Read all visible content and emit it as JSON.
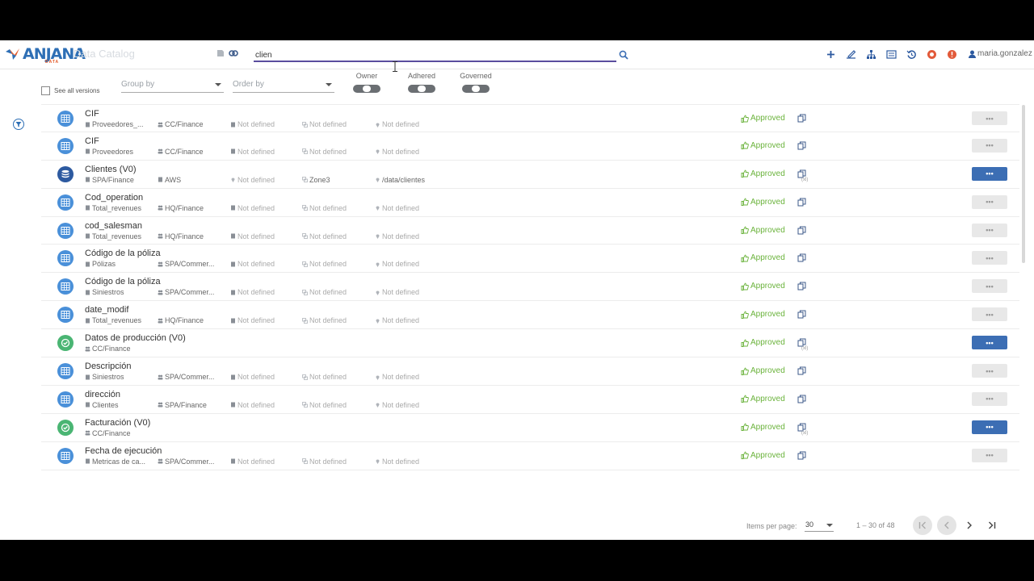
{
  "app": {
    "brand": "ANJANA",
    "brand_sub": "DATA",
    "title": "Data Catalog"
  },
  "search": {
    "value": "clien",
    "placeholder": ""
  },
  "user": {
    "name": "maria.gonzalez"
  },
  "top_actions": [
    {
      "name": "add-icon"
    },
    {
      "name": "edit-lineage-icon"
    },
    {
      "name": "hierarchy-icon"
    },
    {
      "name": "list-view-icon"
    },
    {
      "name": "history-icon"
    },
    {
      "name": "notifications-icon"
    },
    {
      "name": "alerts-icon"
    }
  ],
  "filters": {
    "see_all_versions": "See all versions",
    "group_by": "Group by",
    "order_by": "Order by",
    "owner": "Owner",
    "adhered": "Adhered",
    "governed": "Governed"
  },
  "rows": [
    {
      "name": "CIF",
      "icon": "table",
      "m1": "Proveedores_...",
      "m2": "CC/Finance",
      "m3": "Not defined",
      "m4": "Not defined",
      "m5": "Not defined",
      "status": "Approved",
      "active": false,
      "xl": ""
    },
    {
      "name": "CIF",
      "icon": "table",
      "m1": "Proveedores",
      "m2": "CC/Finance",
      "m3": "Not defined",
      "m4": "Not defined",
      "m5": "Not defined",
      "status": "Approved",
      "active": false,
      "xl": ""
    },
    {
      "name": "Clientes (V0)",
      "icon": "db",
      "m1": "SPA/Finance",
      "m2": "AWS",
      "m3": "Not defined",
      "m4": "Zone3",
      "m5": "/data/clientes",
      "status": "Approved",
      "active": true,
      "xl": "(xl)"
    },
    {
      "name": "Cod_operation",
      "icon": "table",
      "m1": "Total_revenues",
      "m2": "HQ/Finance",
      "m3": "Not defined",
      "m4": "Not defined",
      "m5": "Not defined",
      "status": "Approved",
      "active": false,
      "xl": ""
    },
    {
      "name": "cod_salesman",
      "icon": "table",
      "m1": "Total_revenues",
      "m2": "HQ/Finance",
      "m3": "Not defined",
      "m4": "Not defined",
      "m5": "Not defined",
      "status": "Approved",
      "active": false,
      "xl": ""
    },
    {
      "name": "Código de la póliza",
      "icon": "table",
      "m1": "Pólizas",
      "m2": "SPA/Commer...",
      "m3": "Not defined",
      "m4": "Not defined",
      "m5": "Not defined",
      "status": "Approved",
      "active": false,
      "xl": ""
    },
    {
      "name": "Código de la póliza",
      "icon": "table",
      "m1": "Siniestros",
      "m2": "SPA/Commer...",
      "m3": "Not defined",
      "m4": "Not defined",
      "m5": "Not defined",
      "status": "Approved",
      "active": false,
      "xl": ""
    },
    {
      "name": "date_modif",
      "icon": "table",
      "m1": "Total_revenues",
      "m2": "HQ/Finance",
      "m3": "Not defined",
      "m4": "Not defined",
      "m5": "Not defined",
      "status": "Approved",
      "active": false,
      "xl": ""
    },
    {
      "name": "Datos de producción (V0)",
      "icon": "dp",
      "m1": "CC/Finance",
      "m2": "",
      "m3": "",
      "m4": "",
      "m5": "",
      "status": "Approved",
      "active": true,
      "xl": "(xl)"
    },
    {
      "name": "Descripción",
      "icon": "table",
      "m1": "Siniestros",
      "m2": "SPA/Commer...",
      "m3": "Not defined",
      "m4": "Not defined",
      "m5": "Not defined",
      "status": "Approved",
      "active": false,
      "xl": ""
    },
    {
      "name": "dirección",
      "icon": "table",
      "m1": "Clientes",
      "m2": "SPA/Finance",
      "m3": "Not defined",
      "m4": "Not defined",
      "m5": "Not defined",
      "status": "Approved",
      "active": false,
      "xl": ""
    },
    {
      "name": "Facturación (V0)",
      "icon": "dp",
      "m1": "CC/Finance",
      "m2": "",
      "m3": "",
      "m4": "",
      "m5": "",
      "status": "Approved",
      "active": true,
      "xl": "(xl)"
    },
    {
      "name": "Fecha de ejecución",
      "icon": "table",
      "m1": "Metricas de ca...",
      "m2": "SPA/Commer...",
      "m3": "Not defined",
      "m4": "Not defined",
      "m5": "Not defined",
      "status": "Approved",
      "active": false,
      "xl": ""
    }
  ],
  "more_label": "•••",
  "pager": {
    "items_per_page_label": "Items per page:",
    "items_per_page": "30",
    "range": "1 – 30 of 48"
  },
  "colors": {
    "accent": "#3c6eb4",
    "approved": "#6bb33c",
    "search_underline": "#5a4d9e"
  }
}
